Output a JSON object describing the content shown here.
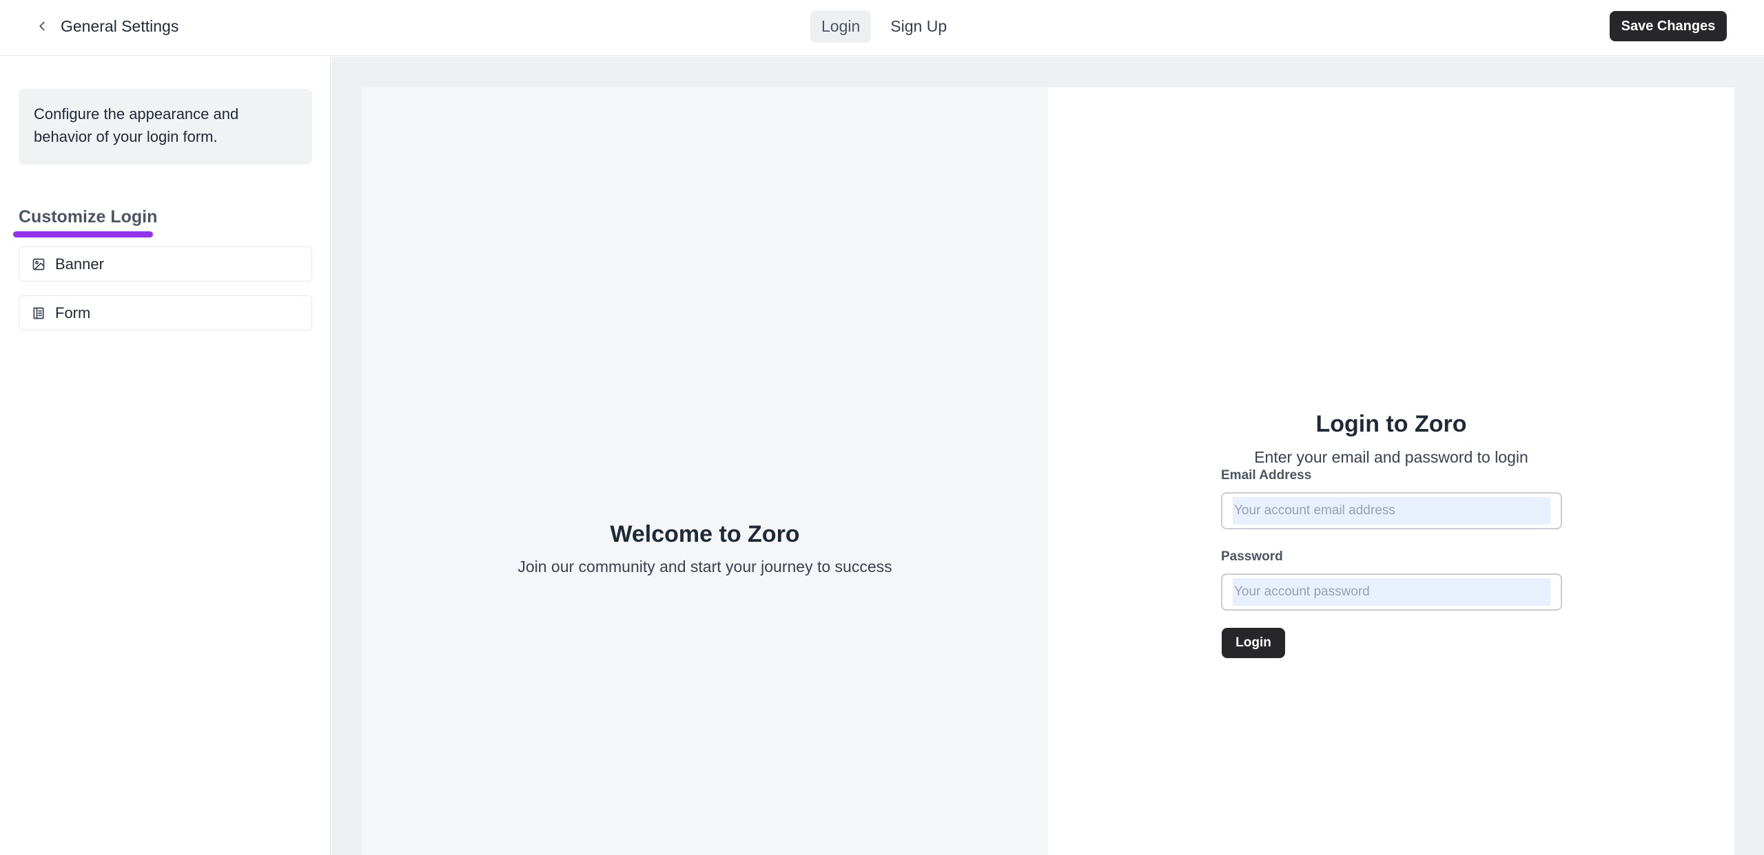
{
  "header": {
    "back_label": "General Settings",
    "tabs": [
      {
        "label": "Login",
        "active": true
      },
      {
        "label": "Sign Up",
        "active": false
      }
    ],
    "save_label": "Save Changes"
  },
  "sidebar": {
    "description": "Configure the appearance and behavior of your login form.",
    "section_title": "Customize Login",
    "items": [
      {
        "label": "Banner",
        "icon": "image-icon"
      },
      {
        "label": "Form",
        "icon": "form-icon"
      }
    ]
  },
  "preview": {
    "banner": {
      "title": "Welcome to Zoro",
      "subtitle": "Join our community and start your journey to success"
    },
    "form": {
      "title": "Login to Zoro",
      "subtitle": "Enter your email and password to login",
      "email_label": "Email Address",
      "email_placeholder": "Your account email address",
      "password_label": "Password",
      "password_placeholder": "Your account password",
      "submit_label": "Login"
    }
  },
  "colors": {
    "accent_underline": "#9333ea",
    "primary_button": "#27272a",
    "autofill_background": "#e8f0fe"
  }
}
